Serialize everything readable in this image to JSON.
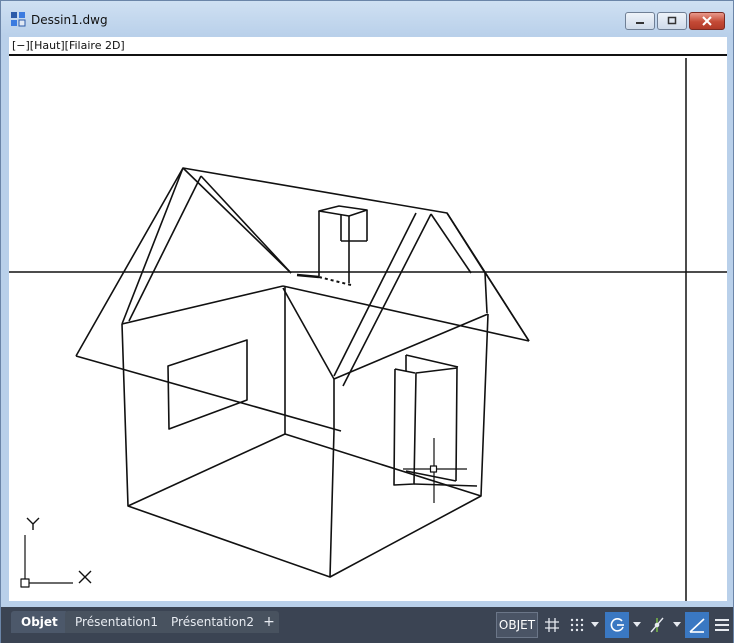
{
  "window": {
    "title": "Dessin1.dwg",
    "icons": {
      "app": "autocad-drawing-icon",
      "minimize": "minimize-icon",
      "maximize": "maximize-icon",
      "close": "close-icon"
    }
  },
  "viewport": {
    "label": "[−][Haut][Filaire 2D]",
    "ucs": {
      "x_label": "X",
      "y_label": "Y"
    }
  },
  "tabs": {
    "model": "Objet",
    "layout1": "Présentation1",
    "layout2": "Présentation2",
    "add": "+"
  },
  "status": {
    "model_space": "OBJET",
    "icons": [
      "grid-icon",
      "snap-icon",
      "snap-dropdown-icon",
      "polar-tracking-icon",
      "polar-dropdown-icon",
      "osnap-icon",
      "osnap-dropdown-icon",
      "ortho-icon",
      "menu-icon"
    ]
  },
  "colors": {
    "statusbar_bg": "#3b4453",
    "active_toggle": "#3a78c2",
    "window_frame": "#b9d0ea",
    "drawing_lines": "#111111"
  }
}
